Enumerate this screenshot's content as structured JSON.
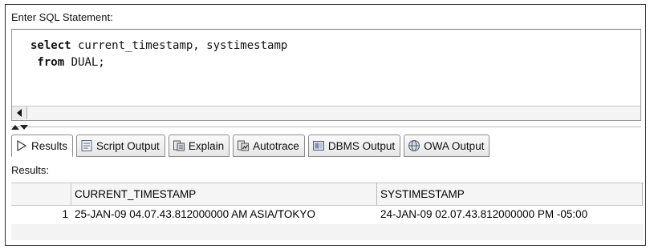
{
  "editor": {
    "label": "Enter SQL Statement:",
    "line1_keyword": "select",
    "line1_rest": " current_timestamp, systimestamp",
    "line2_keyword": " from",
    "line2_rest": " DUAL;"
  },
  "tabs": [
    {
      "label": "Results",
      "icon": "play-triangle-icon",
      "active": true
    },
    {
      "label": "Script Output",
      "icon": "script-output-icon",
      "active": false
    },
    {
      "label": "Explain",
      "icon": "explain-plan-icon",
      "active": false
    },
    {
      "label": "Autotrace",
      "icon": "autotrace-icon",
      "active": false
    },
    {
      "label": "DBMS Output",
      "icon": "dbms-output-icon",
      "active": false
    },
    {
      "label": "OWA Output",
      "icon": "owa-output-icon",
      "active": false
    }
  ],
  "results": {
    "label": "Results:",
    "columns": [
      "CURRENT_TIMESTAMP",
      "SYSTIMESTAMP"
    ],
    "rows": [
      {
        "num": "1",
        "cells": [
          "25-JAN-09 04.07.43.812000000 AM ASIA/TOKYO",
          "24-JAN-09 02.07.43.812000000 PM -05:00"
        ]
      }
    ]
  }
}
